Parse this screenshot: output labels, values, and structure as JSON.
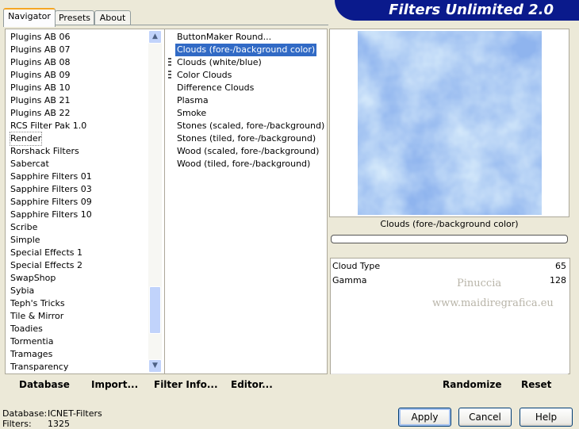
{
  "title": "Filters Unlimited 2.0",
  "tabs": [
    "Navigator",
    "Presets",
    "About"
  ],
  "categories": [
    "Plugins AB 06",
    "Plugins AB 07",
    "Plugins AB 08",
    "Plugins AB 09",
    "Plugins AB 10",
    "Plugins AB 21",
    "Plugins AB 22",
    "RCS Filter Pak 1.0",
    "Render",
    "Rorshack Filters",
    "Sabercat",
    "Sapphire Filters 01",
    "Sapphire Filters 03",
    "Sapphire Filters 09",
    "Sapphire Filters 10",
    "Scribe",
    "Simple",
    "Special Effects 1",
    "Special Effects 2",
    "SwapShop",
    "Sybia",
    "Teph's Tricks",
    "Tile & Mirror",
    "Toadies",
    "Tormentia",
    "Tramages",
    "Transparency"
  ],
  "filters": [
    "ButtonMaker Round...",
    "Clouds (fore-/background color)",
    "Clouds (white/blue)",
    "Color Clouds",
    "Difference Clouds",
    "Plasma",
    "Smoke",
    "Stones (scaled, fore-/background)",
    "Stones (tiled, fore-/background)",
    "Wood (scaled, fore-/background)",
    "Wood (tiled, fore-/background)"
  ],
  "toolbar": {
    "database": "Database",
    "import": "Import...",
    "filter_info": "Filter Info...",
    "editor": "Editor...",
    "randomize": "Randomize",
    "reset": "Reset"
  },
  "preview_caption": "Clouds (fore-/background color)",
  "params": [
    {
      "name": "Cloud Type",
      "value": "65"
    },
    {
      "name": "Gamma",
      "value": "128"
    }
  ],
  "watermark": {
    "line1": "Pinuccia",
    "line2": "www.maidiregrafica.eu"
  },
  "status": {
    "database_label": "Database:",
    "database_value": "ICNET-Filters",
    "filters_label": "Filters:",
    "filters_value": "1325"
  },
  "buttons": {
    "apply": "Apply",
    "cancel": "Cancel",
    "help": "Help"
  },
  "colors": {
    "banner": "#0a1a8c",
    "selection": "#316ac5",
    "preview_light": "#c8e0f8",
    "preview_dark": "#8fb4ee"
  }
}
